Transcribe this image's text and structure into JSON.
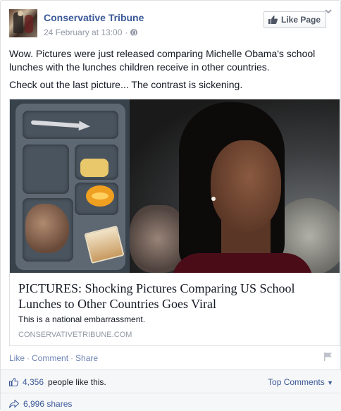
{
  "post": {
    "page_name": "Conservative Tribune",
    "timestamp": "24 February at 13:00",
    "separator": "·",
    "like_page_label": "Like Page",
    "text_paragraphs": [
      "Wow. Pictures were just released comparing Michelle Obama's school lunches with the lunches children receive in other countries.",
      "Check out the last picture... The contrast is sickening."
    ]
  },
  "link": {
    "title": "PICTURES: Shocking Pictures Comparing US School Lunches to Other Countries Goes Viral",
    "description": "This is a national embarrassment.",
    "domain": "CONSERVATIVETRIBUNE.COM"
  },
  "actions": {
    "like": "Like",
    "comment": "Comment",
    "share": "Share",
    "separator": "·"
  },
  "stats": {
    "likes_count": "4,356",
    "likes_suffix": "people like this.",
    "top_comments": "Top Comments",
    "shares": "6,996 shares"
  },
  "colors": {
    "link_blue": "#3b5998",
    "meta_grey": "#9197a3",
    "stats_bg": "#f6f7f8"
  }
}
